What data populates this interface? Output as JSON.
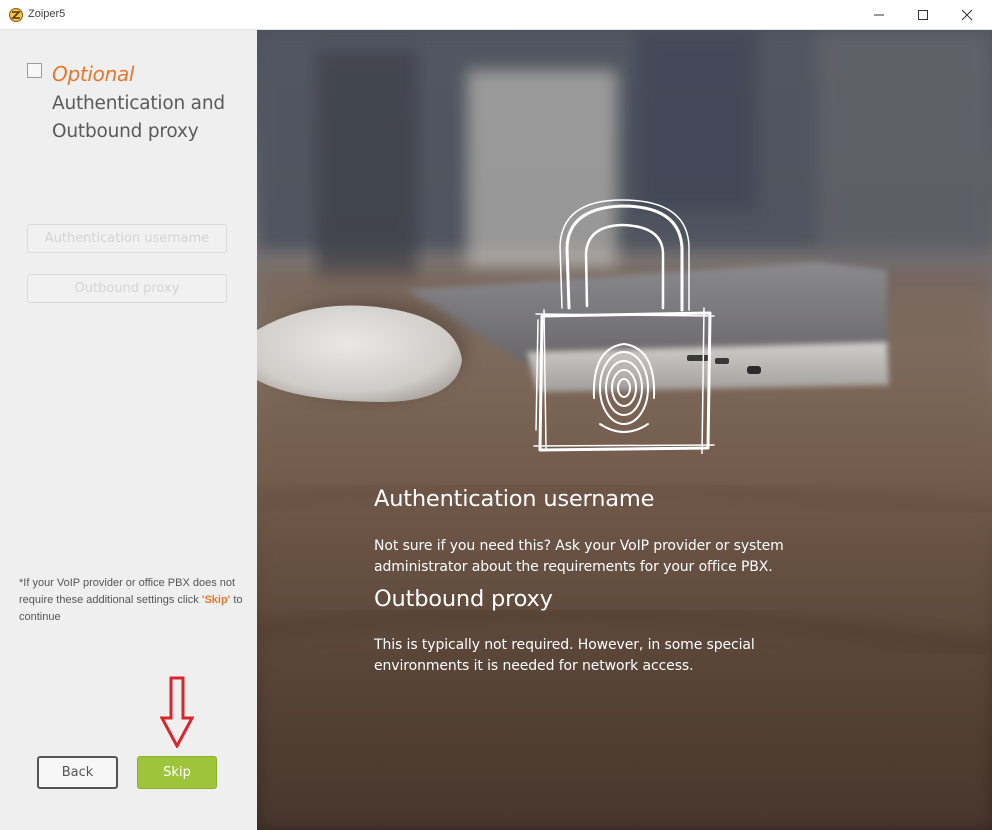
{
  "window": {
    "title": "Zoiper5",
    "icon": "zoiper-logo-icon"
  },
  "sidebar": {
    "optional_label": "Optional",
    "step_title": "Authentication and Outbound proxy",
    "fields": {
      "auth_username_placeholder": "Authentication username",
      "outbound_proxy_placeholder": "Outbound proxy"
    },
    "hint_prefix": "*If your VoIP provider or office PBX does not require these additional settings click ",
    "hint_skip": "'Skip'",
    "hint_suffix": " to continue",
    "buttons": {
      "back": "Back",
      "skip": "Skip"
    },
    "arrow": "red-down-arrow-icon"
  },
  "info": {
    "auth_title": "Authentication username",
    "auth_text": "Not sure if you need this? Ask your VoIP provider or system administrator about the requirements for your office PBX.",
    "proxy_title": "Outbound proxy",
    "proxy_text": "This is typically not required. However, in some special environments it is needed for network access."
  },
  "colors": {
    "accent_orange": "#e8772e",
    "skip_green": "#9dc43a",
    "arrow_red": "#d9262c"
  }
}
